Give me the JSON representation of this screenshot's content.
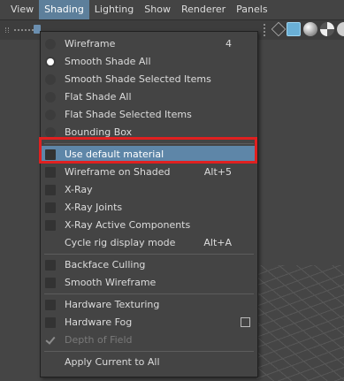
{
  "menubar": {
    "items": [
      {
        "label": "View"
      },
      {
        "label": "Shading"
      },
      {
        "label": "Lighting"
      },
      {
        "label": "Show"
      },
      {
        "label": "Renderer"
      },
      {
        "label": "Panels"
      }
    ],
    "active": "Shading"
  },
  "toolbar": {
    "icons": [
      "wireframe-cube-icon",
      "shaded-cube-icon",
      "smooth-sphere-icon",
      "textured-sphere-icon"
    ]
  },
  "menu": {
    "items": [
      {
        "label": "Wireframe",
        "shortcut": "4",
        "mark": "radio-off"
      },
      {
        "label": "Smooth Shade All",
        "shortcut": "",
        "mark": "radio-on"
      },
      {
        "label": "Smooth Shade Selected Items",
        "shortcut": "",
        "mark": "radio-off"
      },
      {
        "label": "Flat Shade All",
        "shortcut": "",
        "mark": "radio-off"
      },
      {
        "label": "Flat Shade Selected Items",
        "shortcut": "",
        "mark": "radio-off"
      },
      {
        "label": "Bounding Box",
        "shortcut": "",
        "mark": "radio-off"
      },
      {
        "label": "Use default material",
        "shortcut": "",
        "mark": "check-off",
        "highlighted": true
      },
      {
        "label": "Wireframe on Shaded",
        "shortcut": "Alt+5",
        "mark": "check-off"
      },
      {
        "label": "X-Ray",
        "shortcut": "",
        "mark": "check-off"
      },
      {
        "label": "X-Ray Joints",
        "shortcut": "",
        "mark": "check-off"
      },
      {
        "label": "X-Ray Active Components",
        "shortcut": "",
        "mark": "check-off"
      },
      {
        "label": "Cycle rig display mode",
        "shortcut": "Alt+A",
        "mark": "none"
      },
      {
        "label": "Backface Culling",
        "shortcut": "",
        "mark": "check-off"
      },
      {
        "label": "Smooth Wireframe",
        "shortcut": "",
        "mark": "check-off"
      },
      {
        "label": "Hardware Texturing",
        "shortcut": "",
        "mark": "check-off"
      },
      {
        "label": "Hardware Fog",
        "shortcut": "",
        "mark": "check-off",
        "option_box": true
      },
      {
        "label": "Depth of Field",
        "shortcut": "",
        "mark": "check-on",
        "disabled": true
      },
      {
        "label": "Apply Current to All",
        "shortcut": "",
        "mark": "none"
      }
    ]
  },
  "colors": {
    "highlight": "#5e86a8",
    "annotation": "#e02020",
    "menu_bg": "#444444"
  }
}
